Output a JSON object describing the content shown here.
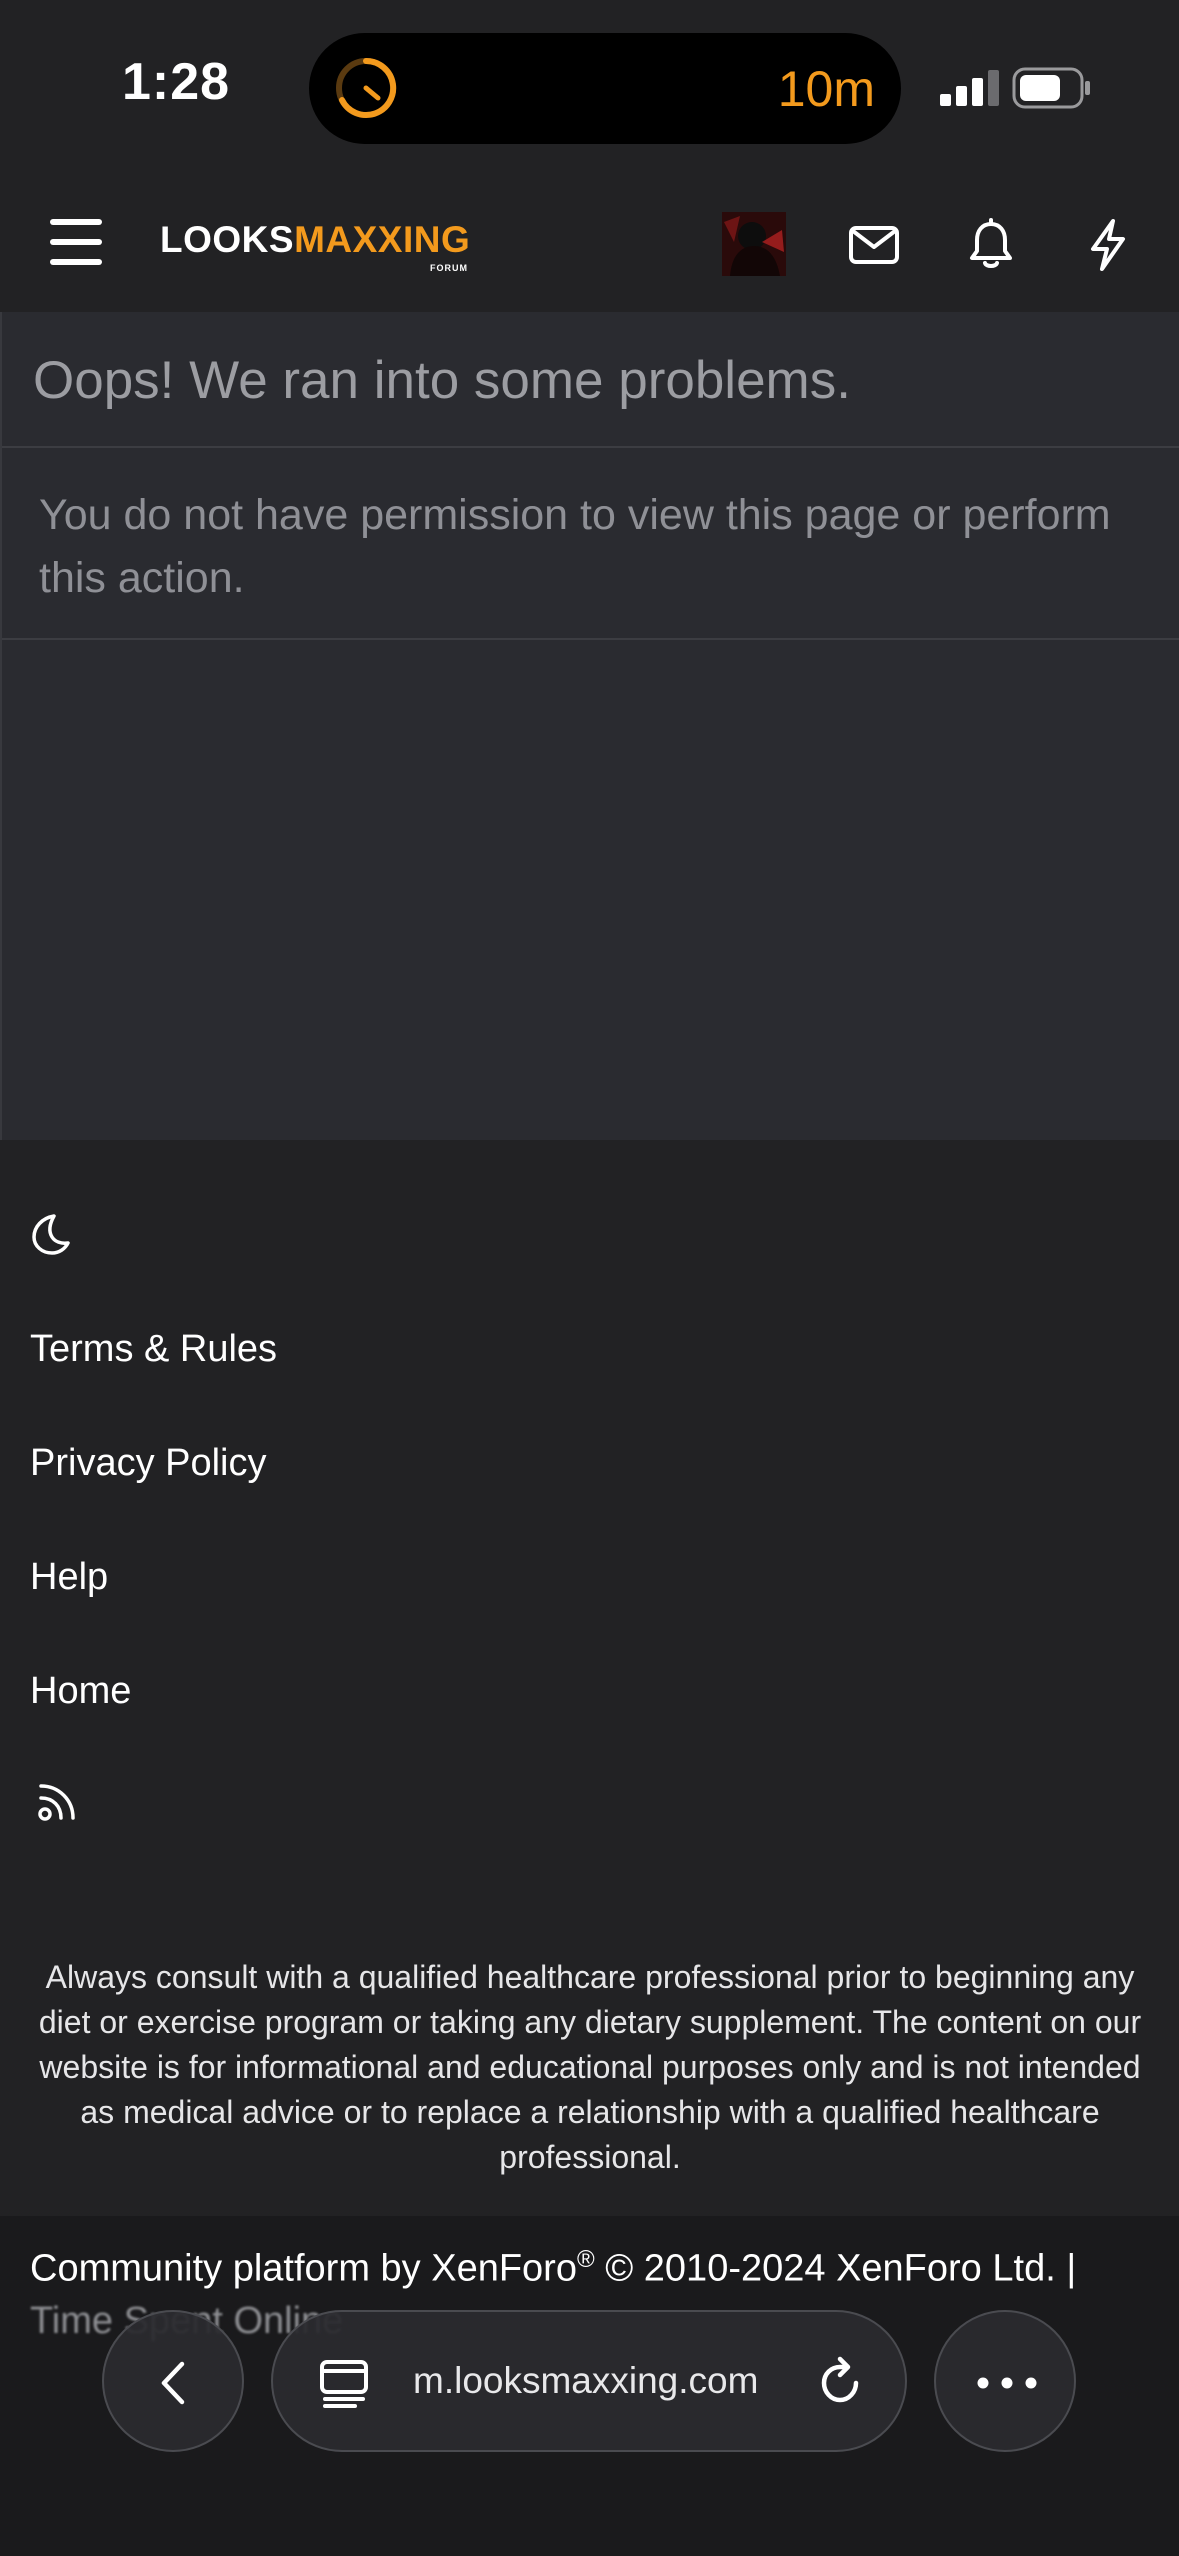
{
  "status_bar": {
    "time": "1:28",
    "island_timer": "10m",
    "colors": {
      "accent": "#f39a1d"
    }
  },
  "header": {
    "logo_part1": "LOOKS",
    "logo_part2": "MAXXING",
    "logo_sub": "FORUM",
    "icons": [
      "menu-icon",
      "avatar",
      "mail-icon",
      "bell-icon",
      "bolt-icon"
    ],
    "colors": {
      "brand": "#f39a1d"
    }
  },
  "error": {
    "title": "Oops! We ran into some problems.",
    "message": "You do not have permission to view this page or perform this action."
  },
  "footer": {
    "links": [
      {
        "label": "Terms & Rules"
      },
      {
        "label": "Privacy Policy"
      },
      {
        "label": "Help"
      },
      {
        "label": "Home"
      }
    ],
    "disclaimer": "Always consult with a qualified healthcare professional prior to beginning any diet or exercise program or taking any dietary supplement. The content on our website is for informational and educational purposes only and is not intended as medical advice or to replace a relationship with a qualified healthcare professional.",
    "copyright_prefix": "Community platform by XenForo",
    "copyright_reg": "®",
    "copyright_suffix": " © 2010-2024 XenForo Ltd. |",
    "time_spent_partial": "Time Spent Online"
  },
  "browser": {
    "url": "m.looksmaxxing.com"
  }
}
